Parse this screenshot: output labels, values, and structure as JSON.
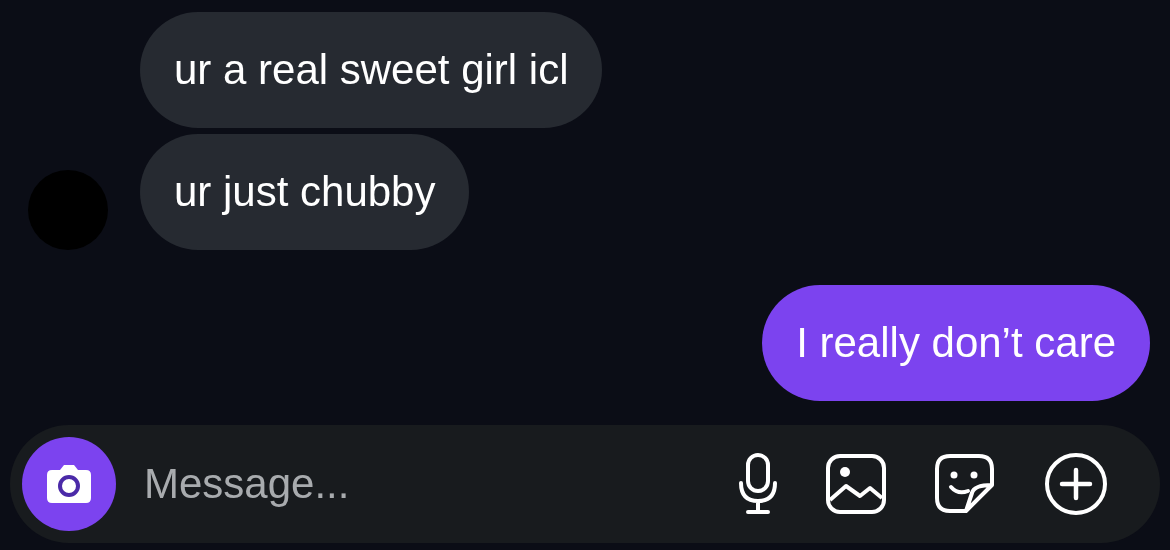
{
  "messages": [
    {
      "kind": "received",
      "text": "ur a real sweet girl icl"
    },
    {
      "kind": "received",
      "text": "ur just chubby"
    },
    {
      "kind": "sent",
      "text": "I really don’t care"
    }
  ],
  "composer": {
    "placeholder": "Message..."
  }
}
